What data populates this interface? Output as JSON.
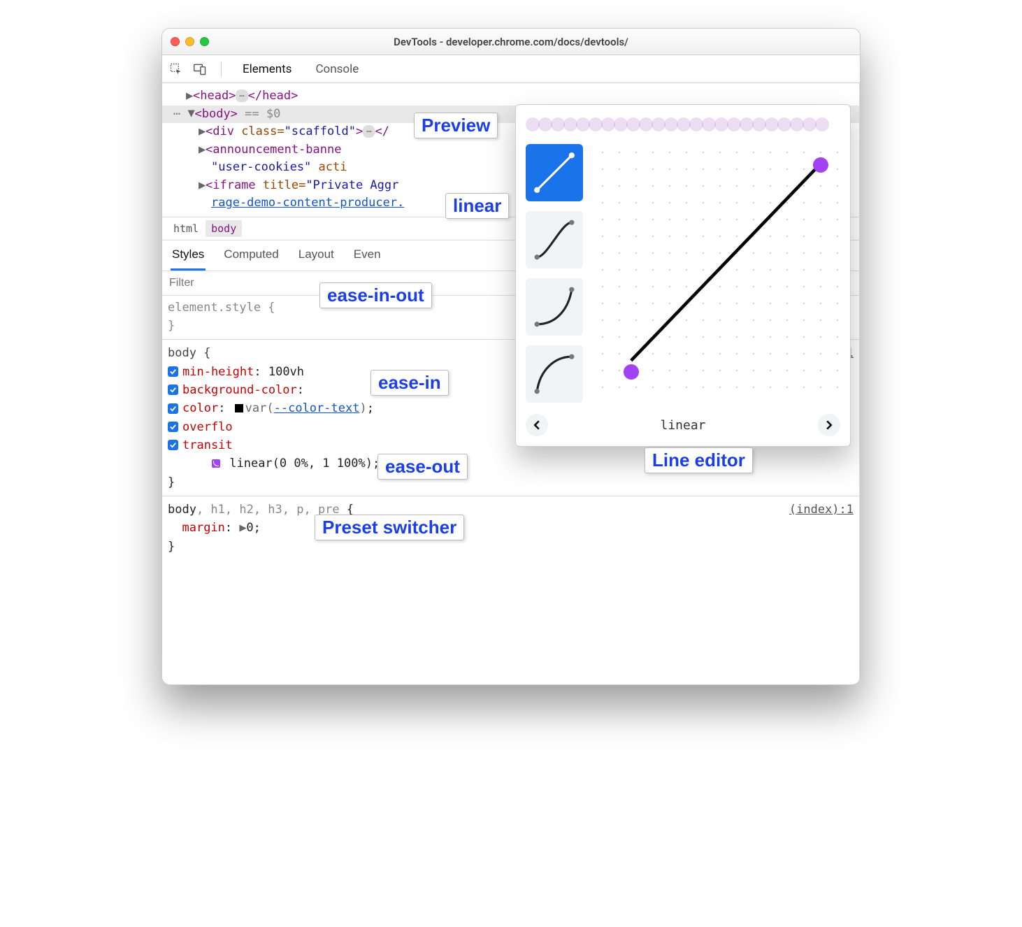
{
  "window": {
    "title": "DevTools - developer.chrome.com/docs/devtools/"
  },
  "toolbar": {
    "tabs": {
      "elements": "Elements",
      "console": "Console"
    }
  },
  "dom": {
    "head_open": "<head>",
    "head_close": "</head>",
    "body_open": "<body>",
    "body_eq": " == $0",
    "div_scaffold_open": "<div ",
    "div_scaffold_class": "class=",
    "div_scaffold_val": "\"scaffold\"",
    "ann_open": "<announcement-banne",
    "user_cookies": "\"user-cookies\"",
    "active": " acti",
    "iframe_open": "<iframe ",
    "iframe_title": "title=",
    "iframe_val": "\"Private Aggr",
    "iframe_src": "rage-demo-content-producer."
  },
  "breadcrumb": {
    "html": "html",
    "body": "body"
  },
  "subtabs": {
    "styles": "Styles",
    "computed": "Computed",
    "layout": "Layout",
    "event": "Even"
  },
  "filter": {
    "placeholder": "Filter"
  },
  "styles": {
    "element_style": "element.style {",
    "brace_close": "}",
    "body_sel": "body {",
    "min_height": "min-height",
    "min_height_v": "100vh",
    "bg": "background-color",
    "color": "color",
    "color_fn": "var(",
    "color_var": "--color-text",
    "paren": ")",
    "overflow": "overflo",
    "transition": "transit",
    "linear_fn": "linear(0 0%, 1 100%)",
    "semi": ";",
    "rule2_sel": "body, h1, h2, h3, p, pre {",
    "margin": "margin",
    "margin_v": "0",
    "srcloc": "(index):1",
    "srcloc2": "1"
  },
  "callouts": {
    "preview": "Preview",
    "linear": "linear",
    "ease_in_out": "ease-in-out",
    "ease_in": "ease-in",
    "ease_out": "ease-out",
    "preset_switcher": "Preset switcher",
    "line_editor": "Line editor"
  },
  "easing": {
    "current": "linear",
    "presets": [
      "linear",
      "ease-in-out",
      "ease-in",
      "ease-out"
    ]
  }
}
